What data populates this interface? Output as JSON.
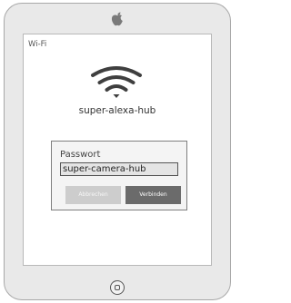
{
  "header": {
    "title": "Wi-Fi"
  },
  "network": {
    "name": "super-alexa-hub",
    "icon": "wifi-icon"
  },
  "password_dialog": {
    "label": "Passwort",
    "value": "super-camera-hub",
    "cancel_label": "Abbrechen",
    "connect_label": "Verbinden"
  },
  "device": {
    "logo_icon": "apple-logo-icon",
    "home_icon": "home-button-icon"
  },
  "colors": {
    "device_frame": "#e9e9e9",
    "connect_button": "#6b6b6b",
    "cancel_button": "#cdcdcd"
  }
}
